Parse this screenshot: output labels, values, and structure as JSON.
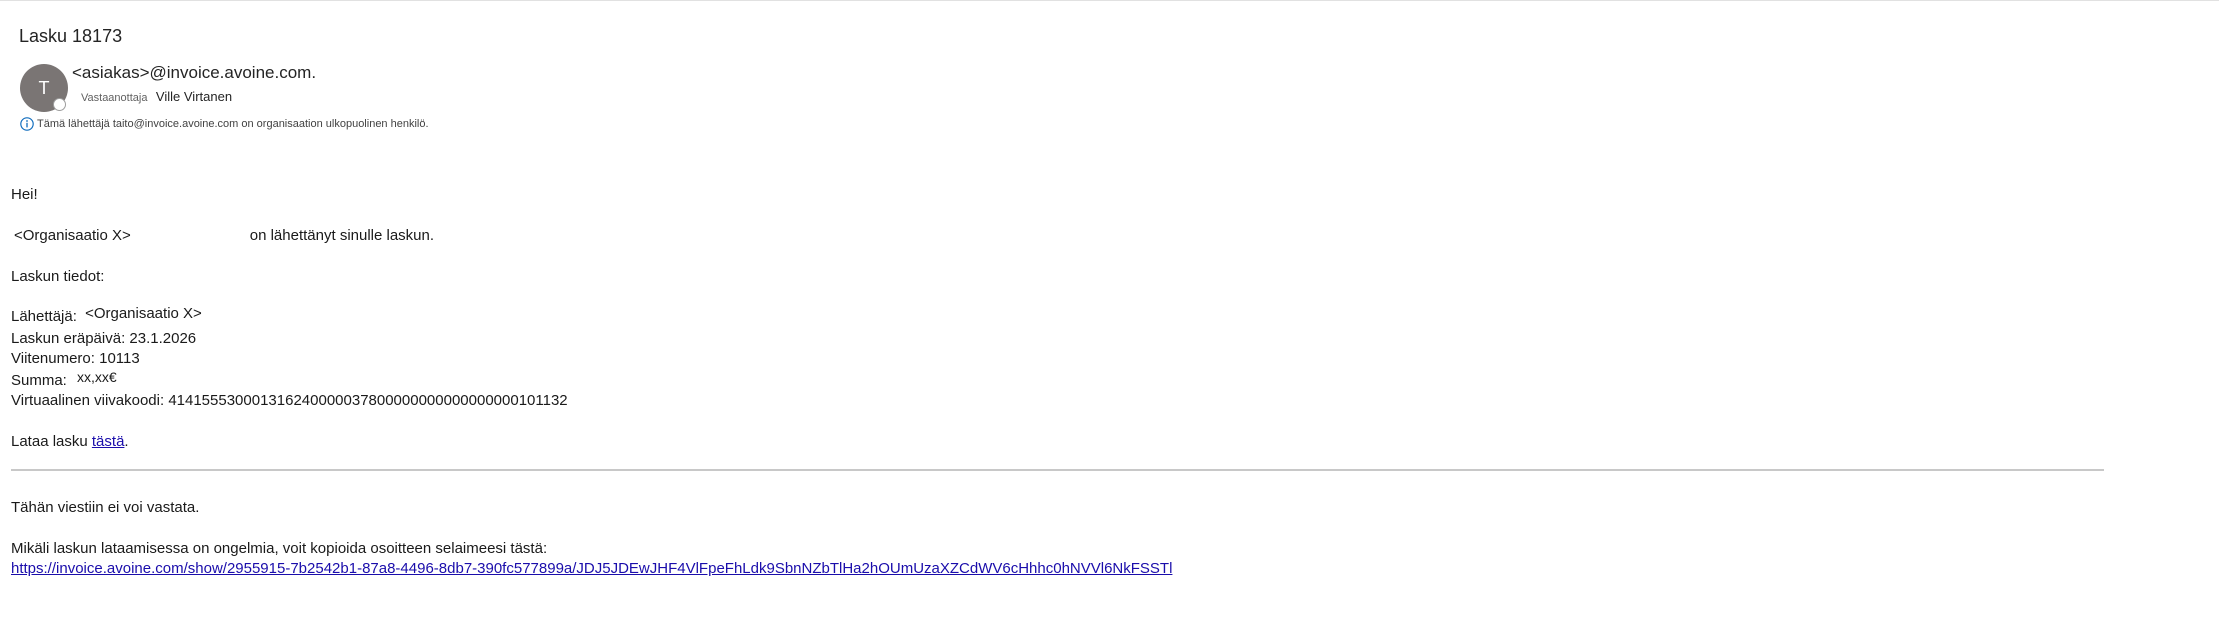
{
  "header": {
    "subject": "Lasku 18173",
    "avatar_initial": "T",
    "sender": "<asiakas>@invoice.avoine.com.",
    "recipient_label": "Vastaanottaja",
    "recipient_name": "Ville Virtanen",
    "external_notice": "Tämä lähettäjä taito@invoice.avoine.com on organisaation ulkopuolinen henkilö."
  },
  "body": {
    "greeting": "Hei!",
    "organisation": "<Organisaatio X>",
    "sent_text": "on lähettänyt sinulle laskun.",
    "details_heading": "Laskun tiedot:",
    "sender_label": "Lähettäjä:",
    "sender_value": "<Organisaatio X>",
    "due_date": "Laskun eräpäivä: 23.1.2026",
    "reference": "Viitenumero: 10113",
    "amount_label": "Summa:",
    "amount_value": "xx,xx€",
    "barcode": "Virtuaalinen viivakoodi: 414155530001316240000037800000000000000000101132",
    "download_prefix": "Lataa lasku ",
    "download_link": "tästä",
    "download_suffix": ".",
    "no_reply": "Tähän viestiin ei voi vastata.",
    "problem_text": "Mikäli laskun lataamisessa on ongelmia, voit kopioida osoitteen selaimeesi tästä:",
    "url": "https://invoice.avoine.com/show/2955915-7b2542b1-87a8-4496-8db7-390fc577899a/JDJ5JDEwJHF4VlFpeFhLdk9SbnNZbTlHa2hOUmUzaXZCdWV6cHhhc0hNVVl6NkFSSTl"
  },
  "colors": {
    "link": "#1a0dab",
    "avatar_bg": "#7a7574",
    "info_icon": "#0f6cbd",
    "separator": "#c8c8c8"
  },
  "icons": {
    "info": "info-icon",
    "presence": "presence-status-icon"
  }
}
